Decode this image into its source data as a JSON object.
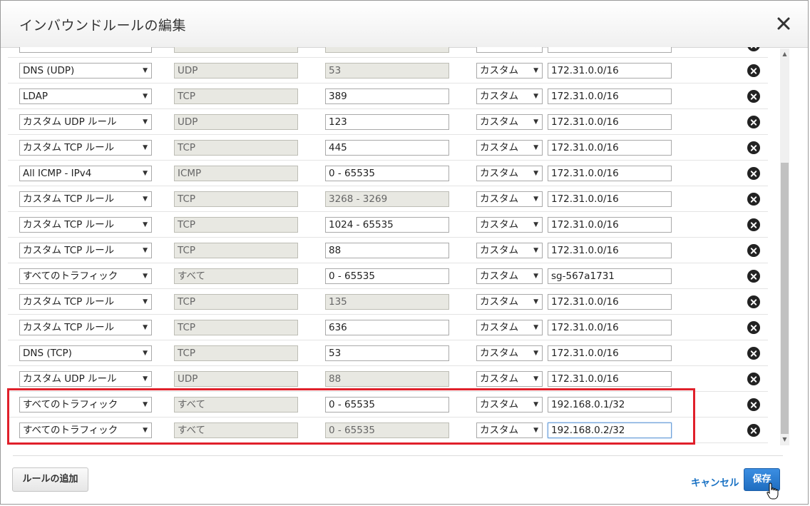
{
  "dialog": {
    "title": "インバウンドルールの編集",
    "close_icon": "close-icon"
  },
  "rules": [
    {
      "type": "",
      "protocol": "",
      "port": "",
      "source_mode": "",
      "source": ""
    },
    {
      "type": "DNS (UDP)",
      "protocol": "UDP",
      "port": "53",
      "source_mode": "カスタム",
      "source": "172.31.0.0/16"
    },
    {
      "type": "LDAP",
      "protocol": "TCP",
      "port": "389",
      "source_mode": "カスタム",
      "source": "172.31.0.0/16"
    },
    {
      "type": "カスタム UDP ルール",
      "protocol": "UDP",
      "port": "123",
      "source_mode": "カスタム",
      "source": "172.31.0.0/16"
    },
    {
      "type": "カスタム TCP ルール",
      "protocol": "TCP",
      "port": "445",
      "source_mode": "カスタム",
      "source": "172.31.0.0/16"
    },
    {
      "type": "All ICMP - IPv4",
      "protocol": "ICMP",
      "port": "0 - 65535",
      "source_mode": "カスタム",
      "source": "172.31.0.0/16"
    },
    {
      "type": "カスタム TCP ルール",
      "protocol": "TCP",
      "port": "3268 - 3269",
      "source_mode": "カスタム",
      "source": "172.31.0.0/16"
    },
    {
      "type": "カスタム TCP ルール",
      "protocol": "TCP",
      "port": "1024 - 65535",
      "source_mode": "カスタム",
      "source": "172.31.0.0/16"
    },
    {
      "type": "カスタム TCP ルール",
      "protocol": "TCP",
      "port": "88",
      "source_mode": "カスタム",
      "source": "172.31.0.0/16"
    },
    {
      "type": "すべてのトラフィック",
      "protocol": "すべて",
      "port": "0 - 65535",
      "source_mode": "カスタム",
      "source": "sg-567a1731"
    },
    {
      "type": "カスタム TCP ルール",
      "protocol": "TCP",
      "port": "135",
      "source_mode": "カスタム",
      "source": "172.31.0.0/16"
    },
    {
      "type": "カスタム TCP ルール",
      "protocol": "TCP",
      "port": "636",
      "source_mode": "カスタム",
      "source": "172.31.0.0/16"
    },
    {
      "type": "DNS (TCP)",
      "protocol": "TCP",
      "port": "53",
      "source_mode": "カスタム",
      "source": "172.31.0.0/16"
    },
    {
      "type": "カスタム UDP ルール",
      "protocol": "UDP",
      "port": "88",
      "source_mode": "カスタム",
      "source": "172.31.0.0/16"
    },
    {
      "type": "すべてのトラフィック",
      "protocol": "すべて",
      "port": "0 - 65535",
      "source_mode": "カスタム",
      "source": "192.168.0.1/32"
    },
    {
      "type": "すべてのトラフィック",
      "protocol": "すべて",
      "port": "0 - 65535",
      "source_mode": "カスタム",
      "source": "192.168.0.2/32"
    }
  ],
  "port_readonly": [
    true,
    true,
    false,
    false,
    false,
    false,
    true,
    false,
    false,
    false,
    true,
    false,
    false,
    true,
    false,
    true,
    true
  ],
  "focused_row": 15,
  "footer": {
    "add_rule_label": "ルールの追加",
    "cancel_label": "キャンセル",
    "save_label": "保存"
  },
  "colors": {
    "highlight": "#e0202b",
    "primary_button": "#1f6dc0",
    "link": "#1a72c4"
  }
}
